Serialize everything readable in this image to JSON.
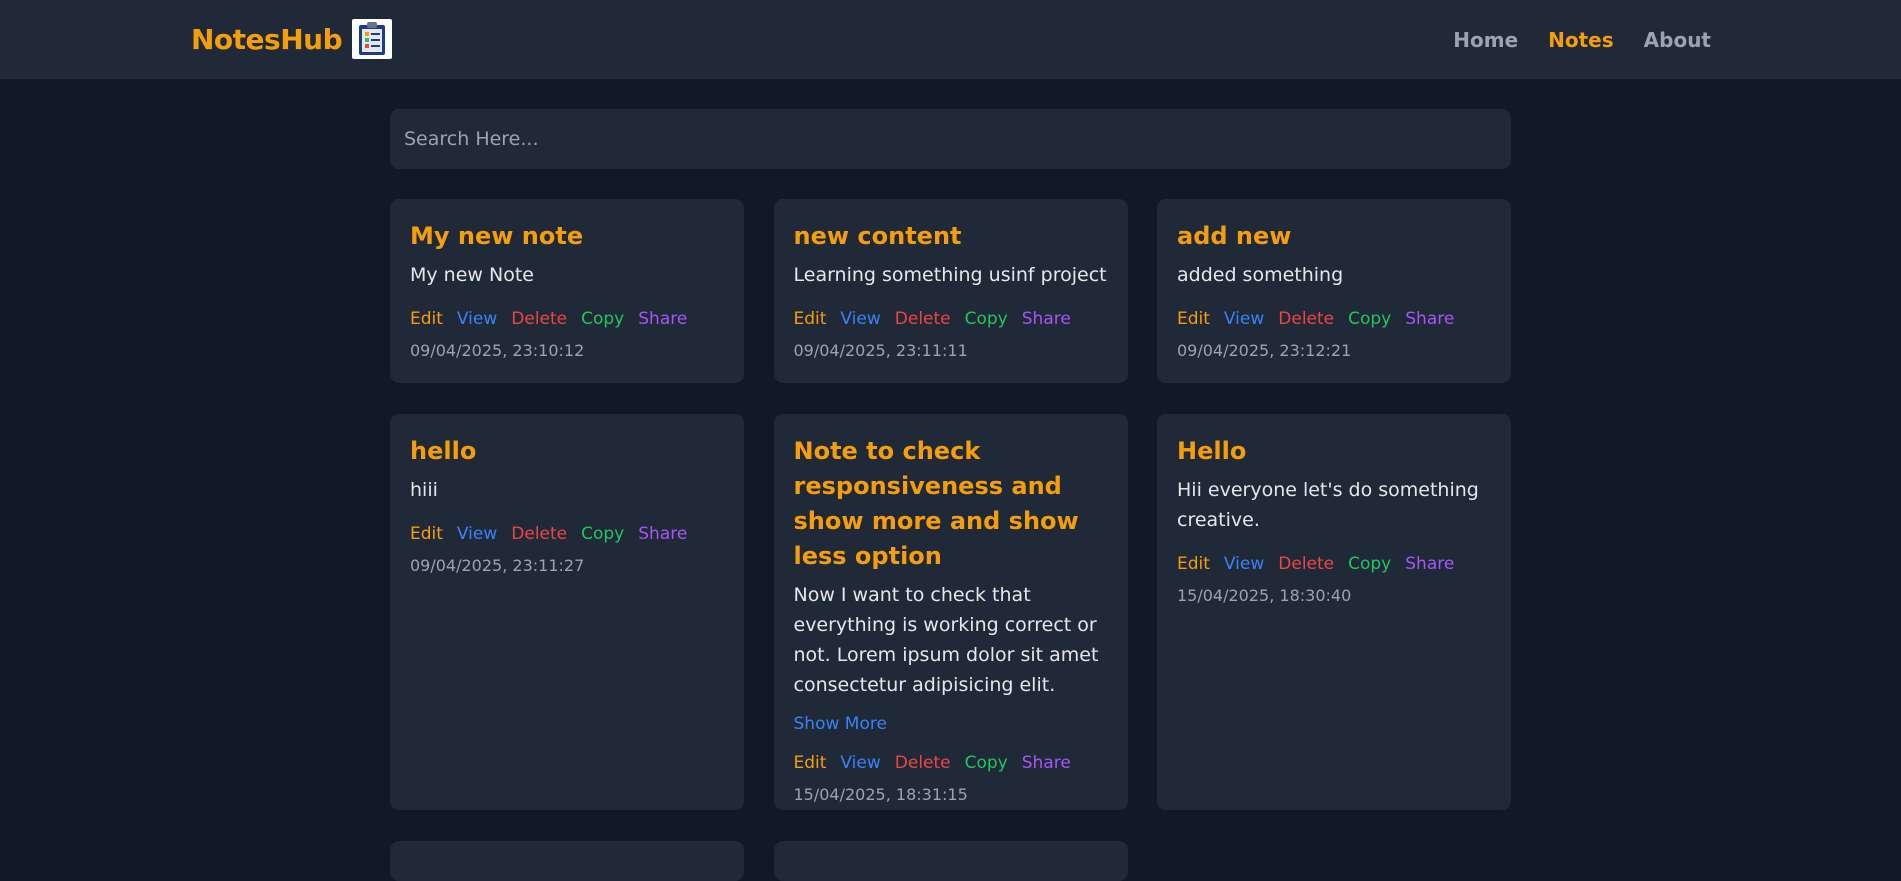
{
  "navbar": {
    "brand": "NotesHub",
    "links": [
      {
        "label": "Home",
        "active": false
      },
      {
        "label": "Notes",
        "active": true
      },
      {
        "label": "About",
        "active": false
      }
    ]
  },
  "search": {
    "placeholder": "Search Here...",
    "value": ""
  },
  "actions": {
    "edit": "Edit",
    "view": "View",
    "delete": "Delete",
    "copy": "Copy",
    "share": "Share"
  },
  "notes": [
    {
      "title": "My new note",
      "content": "My new Note",
      "date": "09/04/2025, 23:10:12"
    },
    {
      "title": "new content",
      "content": "Learning something usinf project",
      "date": "09/04/2025, 23:11:11"
    },
    {
      "title": "add new",
      "content": "added something",
      "date": "09/04/2025, 23:12:21"
    },
    {
      "title": "hello",
      "content": "hiii",
      "date": "09/04/2025, 23:11:27"
    },
    {
      "title": "Note to check responsiveness and show more and show less option",
      "content": "Now I want to check that everything is working correct or not. Lorem ipsum dolor sit amet consectetur adipisicing elit.",
      "show_more": "Show More",
      "date": "15/04/2025, 18:31:15"
    },
    {
      "title": "Hello",
      "content": "Hii everyone let's do something creative.",
      "date": "15/04/2025, 18:30:40"
    }
  ],
  "colors": {
    "background": "#111827",
    "surface": "#1f2937",
    "accent": "#f59e0b",
    "view": "#3b82f6",
    "delete": "#ef4444",
    "copy": "#22c55e",
    "share": "#a855f7"
  }
}
